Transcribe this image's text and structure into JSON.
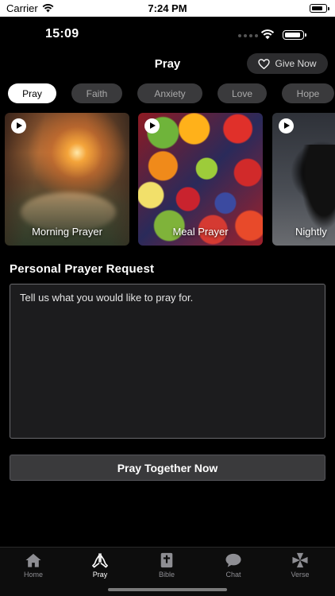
{
  "outer_status": {
    "carrier": "Carrier",
    "time": "7:24 PM"
  },
  "inner_status": {
    "clock": "15:09"
  },
  "header": {
    "title": "Pray",
    "give_label": "Give Now"
  },
  "categories": [
    {
      "label": "Pray",
      "active": true
    },
    {
      "label": "Faith",
      "active": false
    },
    {
      "label": "Anxiety",
      "active": false
    },
    {
      "label": "Love",
      "active": false
    },
    {
      "label": "Hope",
      "active": false
    }
  ],
  "cards": [
    {
      "label": "Morning Prayer"
    },
    {
      "label": "Meal Prayer"
    },
    {
      "label": "Nightly"
    }
  ],
  "request": {
    "title": "Personal Prayer Request",
    "placeholder": "Tell us what you would like to pray for."
  },
  "pray_button": "Pray Together Now",
  "tabs": [
    {
      "label": "Home",
      "icon": "home-icon",
      "active": false
    },
    {
      "label": "Pray",
      "icon": "praying-hands-icon",
      "active": true
    },
    {
      "label": "Bible",
      "icon": "bible-icon",
      "active": false
    },
    {
      "label": "Chat",
      "icon": "chat-bubble-icon",
      "active": false
    },
    {
      "label": "Verse",
      "icon": "cross-icon",
      "active": false
    }
  ]
}
